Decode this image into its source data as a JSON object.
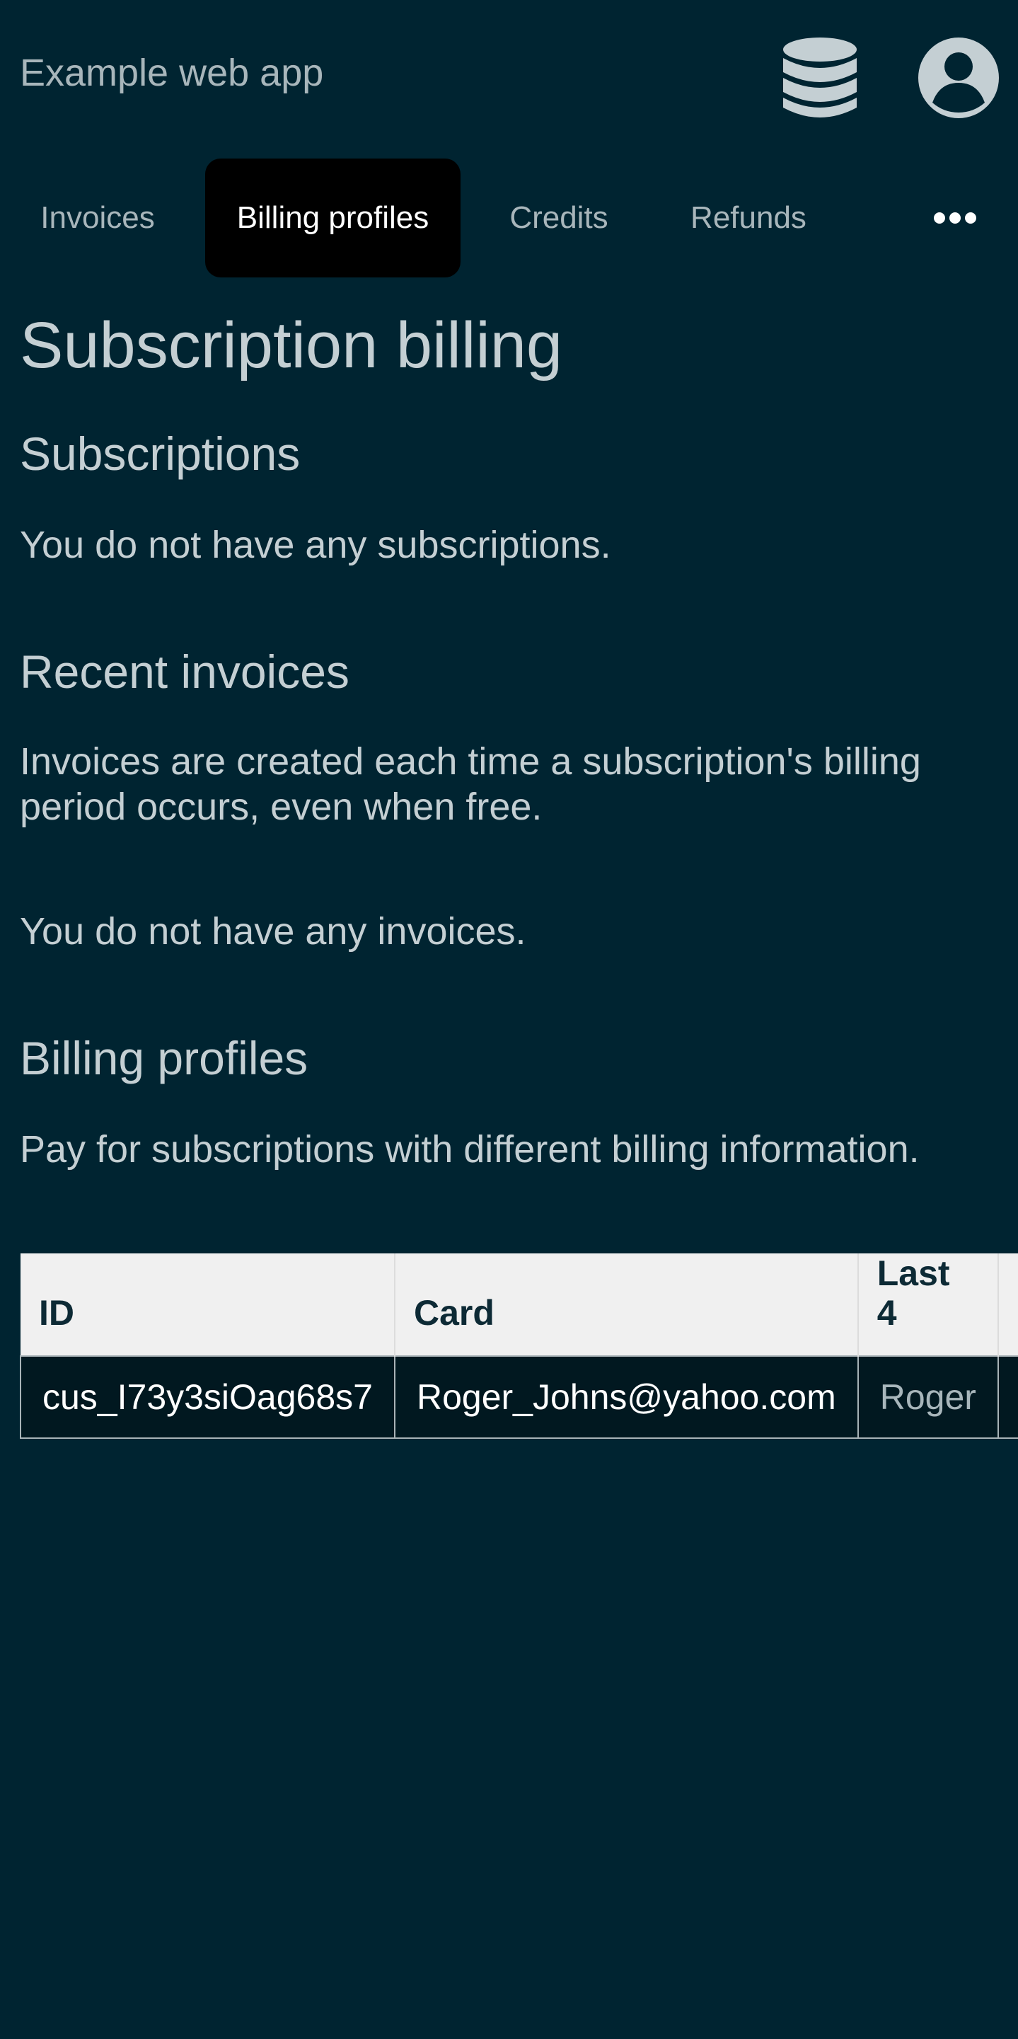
{
  "header": {
    "app_title": "Example web app",
    "database_icon": "database-icon",
    "user_icon": "user-account-icon"
  },
  "tabs": [
    {
      "label": "Invoices",
      "active": false
    },
    {
      "label": "Billing profiles",
      "active": true
    },
    {
      "label": "Credits",
      "active": false
    },
    {
      "label": "Refunds",
      "active": false
    }
  ],
  "more_icon": "more-horizontal-icon",
  "page": {
    "title": "Subscription billing",
    "subscriptions": {
      "heading": "Subscriptions",
      "empty_text": "You do not have any subscriptions."
    },
    "invoices": {
      "heading": "Recent invoices",
      "description": "Invoices are created each time a subscription's billing period occurs, even when free.",
      "empty_text": "You do not have any invoices."
    },
    "billing_profiles": {
      "heading": "Billing profiles",
      "description": "Pay for subscriptions with different billing information.",
      "table": {
        "columns": [
          "ID",
          "Card",
          "Last 4"
        ],
        "rows": [
          [
            "cus_I73y3siOag68s7",
            "Roger_Johns@yahoo.com",
            "Roger"
          ]
        ]
      }
    }
  },
  "colors": {
    "background": "#002431",
    "active_tab": "#000000",
    "text": "#c4cfd3",
    "table_header_bg": "#f0f0f0"
  }
}
